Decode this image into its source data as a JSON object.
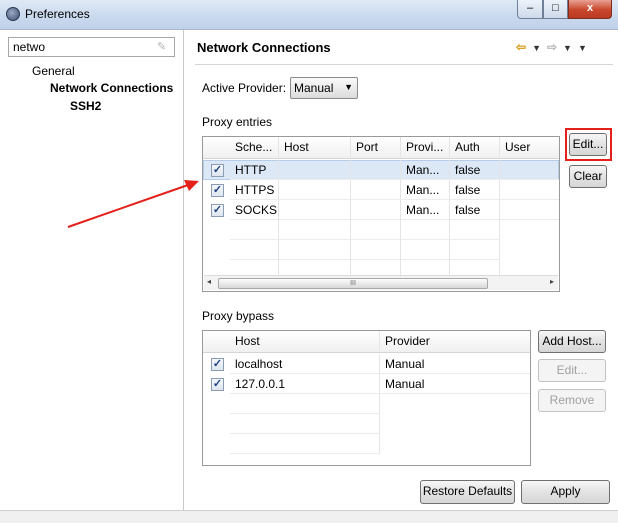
{
  "window": {
    "title": "Preferences",
    "controls": {
      "minimize": "–",
      "maximize": "□",
      "close": "x"
    }
  },
  "sidebar": {
    "filter_value": "netwo",
    "tree": [
      {
        "label": "General"
      },
      {
        "label": "Network Connections"
      },
      {
        "label": "SSH2"
      }
    ]
  },
  "page": {
    "title": "Network Connections",
    "nav": {
      "back": "⇦",
      "dropdown": "▼",
      "forward": "⇨"
    }
  },
  "active_provider": {
    "label": "Active Provider:",
    "selected": "Manual"
  },
  "proxy_entries": {
    "label": "Proxy entries",
    "columns": [
      "Sche...",
      "Host",
      "Port",
      "Provi...",
      "Auth",
      "User"
    ],
    "rows": [
      {
        "checked": true,
        "scheme": "HTTP",
        "host": "",
        "port": "",
        "provider": "Man...",
        "auth": "false",
        "user": ""
      },
      {
        "checked": true,
        "scheme": "HTTPS",
        "host": "",
        "port": "",
        "provider": "Man...",
        "auth": "false",
        "user": ""
      },
      {
        "checked": true,
        "scheme": "SOCKS",
        "host": "",
        "port": "",
        "provider": "Man...",
        "auth": "false",
        "user": ""
      }
    ],
    "buttons": {
      "edit": "Edit...",
      "clear": "Clear"
    },
    "scroll": {
      "left": "◂",
      "grip": "III",
      "right": "▸"
    }
  },
  "proxy_bypass": {
    "label": "Proxy bypass",
    "columns": [
      "Host",
      "Provider"
    ],
    "rows": [
      {
        "checked": true,
        "host": "localhost",
        "provider": "Manual"
      },
      {
        "checked": true,
        "host": "127.0.0.1",
        "provider": "Manual"
      }
    ],
    "buttons": {
      "add_host": "Add Host...",
      "edit": "Edit...",
      "remove": "Remove"
    }
  },
  "footer": {
    "restore_defaults": "Restore Defaults",
    "apply": "Apply"
  },
  "colors": {
    "annotation": "#e3211a",
    "selection": "#dde8f6"
  },
  "icons": {
    "app": "eclipse-preferences-icon",
    "check": "✓",
    "clear_filter": "eraser-icon"
  }
}
